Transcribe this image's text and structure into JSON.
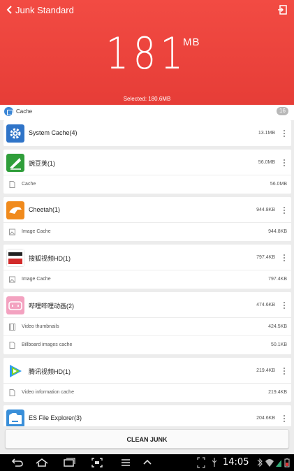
{
  "header": {
    "title": "Junk Standard",
    "size_value": "181",
    "size_unit": "MB",
    "selected_text": "Selected: 180.6MB",
    "accent_color": "#e8433c"
  },
  "section": {
    "label": "Cache",
    "count": "16"
  },
  "items": [
    {
      "name": "System Cache(4)",
      "size": "13.1MB",
      "icon": "gear-icon",
      "subs": []
    },
    {
      "name": "豌豆荚(1)",
      "size": "56.0MB",
      "icon": "wandoujia-icon",
      "subs": [
        {
          "name": "Cache",
          "size": "56.0MB",
          "icon": "file-icon"
        }
      ]
    },
    {
      "name": "Cheetah(1)",
      "size": "944.8KB",
      "icon": "cheetah-icon",
      "subs": [
        {
          "name": "Image Cache",
          "size": "944.8KB",
          "icon": "image-icon"
        }
      ]
    },
    {
      "name": "搜狐视频HD(1)",
      "size": "797.4KB",
      "icon": "sohu-video-icon",
      "subs": [
        {
          "name": "Image Cache",
          "size": "797.4KB",
          "icon": "image-icon"
        }
      ]
    },
    {
      "name": "哔哩哔哩动画(2)",
      "size": "474.6KB",
      "icon": "bilibili-icon",
      "subs": [
        {
          "name": "Video thumbnails",
          "size": "424.5KB",
          "icon": "film-icon"
        },
        {
          "name": "Billboard images cache",
          "size": "50.1KB",
          "icon": "file-icon"
        }
      ]
    },
    {
      "name": "腾讯视频HD(1)",
      "size": "219.4KB",
      "icon": "tencent-video-icon",
      "subs": [
        {
          "name": "Video information cache",
          "size": "219.4KB",
          "icon": "file-icon"
        }
      ]
    },
    {
      "name": "ES File Explorer(3)",
      "size": "204.6KB",
      "icon": "es-file-explorer-icon",
      "subs": []
    }
  ],
  "clean_button": "CLEAN JUNK",
  "status_bar": {
    "time": "14:05"
  }
}
